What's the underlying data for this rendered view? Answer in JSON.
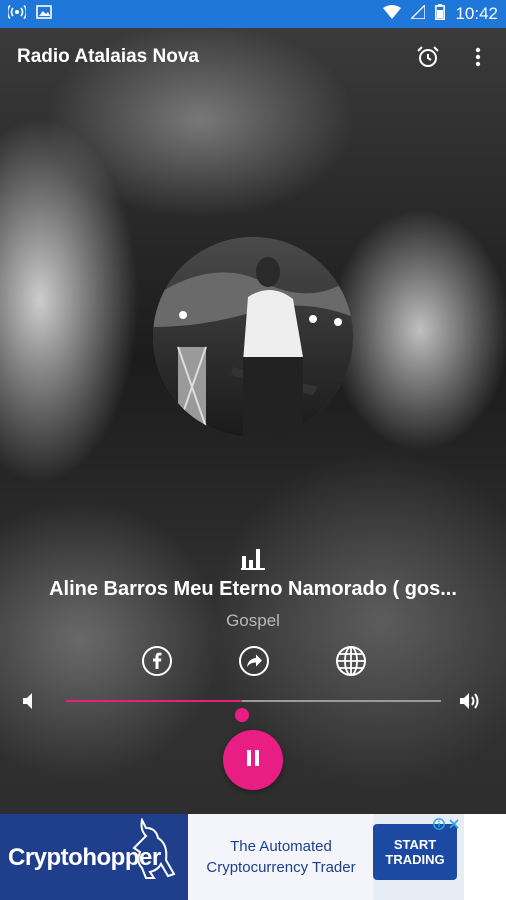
{
  "status_bar": {
    "time": "10:42",
    "icons": [
      "hotspot-icon",
      "image-icon",
      "wifi-icon",
      "signal-icon",
      "battery-icon"
    ],
    "color": "#1f78d9"
  },
  "app_bar": {
    "title": "Radio Atalaias Nova",
    "actions": [
      "alarm-icon",
      "more-vert-icon"
    ]
  },
  "now_playing": {
    "song_title": "Aline Barros   Meu Eterno Namorado  (  gos...",
    "genre": "Gospel",
    "artwork": "circular-album-photo"
  },
  "share": {
    "icons": [
      "facebook-icon",
      "share-icon",
      "globe-icon"
    ]
  },
  "volume": {
    "level": 0.47,
    "accent": "#e91e84"
  },
  "player": {
    "state": "playing",
    "button_icon": "pause-icon",
    "accent": "#e91e84"
  },
  "ad": {
    "brand": "Cryptohopper",
    "headline_line1": "The Automated",
    "headline_line2": "Cryptocurrency Trader",
    "cta_line1": "START",
    "cta_line2": "TRADING",
    "brand_color": "#1f3f8c"
  }
}
